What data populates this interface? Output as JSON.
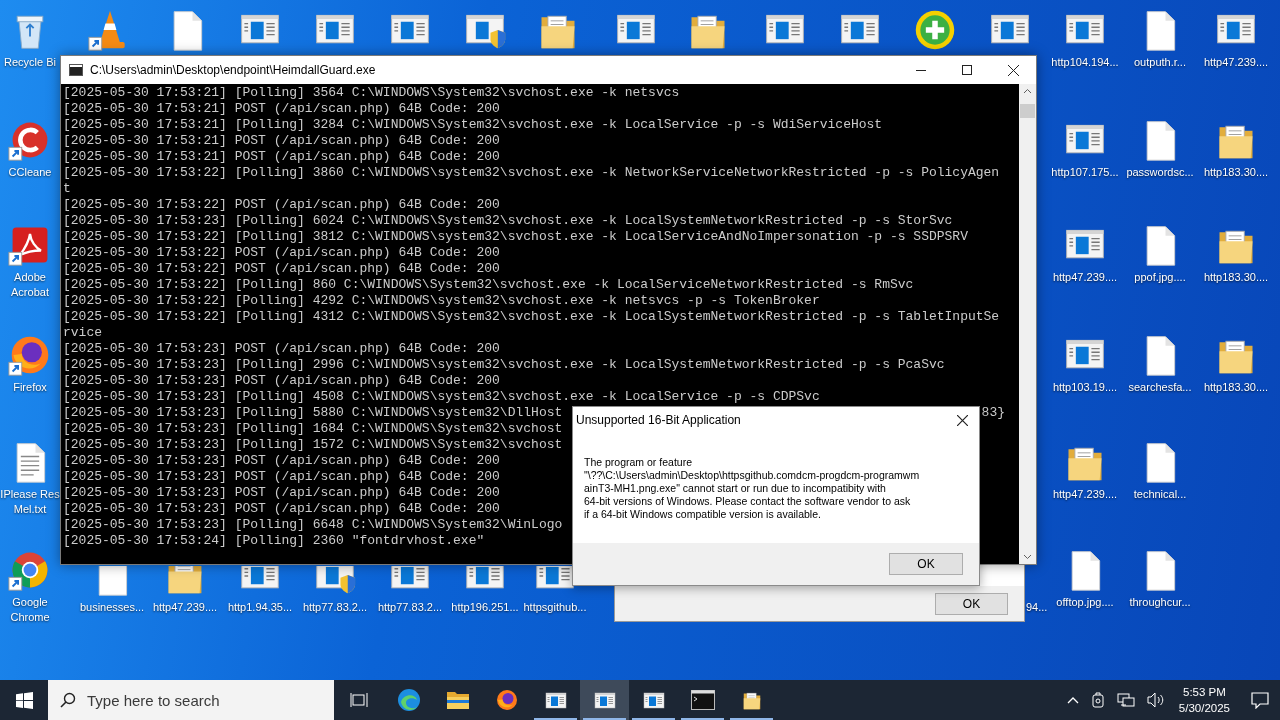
{
  "desktop_icons": [
    {
      "kind": "recycle",
      "label": "Recycle Bi",
      "shortcut": false
    },
    {
      "kind": "ccleaner",
      "label": "CCleane",
      "shortcut": true
    },
    {
      "kind": "acrobat",
      "label": "Adobe\nAcrobat",
      "shortcut": true
    },
    {
      "kind": "firefox",
      "label": "Firefox",
      "shortcut": true
    },
    {
      "kind": "txt",
      "label": "IPlease Res\nMel.txt",
      "shortcut": false
    },
    {
      "kind": "chrome",
      "label": "Google\nChrome",
      "shortcut": true
    },
    {
      "kind": "vlc",
      "shortcut": true
    },
    {
      "kind": "doc",
      "shortcut": false
    },
    {
      "kind": "exe",
      "shortcut": false
    },
    {
      "kind": "exe",
      "shortcut": false
    },
    {
      "kind": "exe",
      "shortcut": false
    },
    {
      "kind": "shield",
      "shortcut": false
    },
    {
      "kind": "folder",
      "shortcut": false
    },
    {
      "kind": "exe",
      "shortcut": false
    },
    {
      "kind": "folder",
      "shortcut": false
    },
    {
      "kind": "exe",
      "shortcut": false
    },
    {
      "kind": "exe",
      "shortcut": false
    },
    {
      "kind": "plus",
      "shortcut": false
    },
    {
      "kind": "exe",
      "shortcut": false
    },
    {
      "kind": "exe",
      "label": "http104.194...",
      "shortcut": false
    },
    {
      "kind": "exe",
      "label": "http107.175...",
      "shortcut": false
    },
    {
      "kind": "exe",
      "label": "http47.239....",
      "shortcut": false
    },
    {
      "kind": "exe",
      "label": "http103.19....",
      "shortcut": false
    },
    {
      "kind": "folder",
      "label": "http47.239....",
      "shortcut": false
    },
    {
      "kind": "doc",
      "label": "offtop.jpg....",
      "shortcut": false
    },
    {
      "kind": "doc",
      "label": "outputh.r...",
      "shortcut": false
    },
    {
      "kind": "doc",
      "label": "passwordsc...",
      "shortcut": false
    },
    {
      "kind": "doc",
      "label": "ppof.jpg....",
      "shortcut": false
    },
    {
      "kind": "doc",
      "label": "searchesfa...",
      "shortcut": false
    },
    {
      "kind": "doc",
      "label": "technical...",
      "shortcut": false
    },
    {
      "kind": "doc",
      "label": "throughcur...",
      "shortcut": false
    },
    {
      "kind": "exe",
      "label": "http47.239....",
      "shortcut": false
    },
    {
      "kind": "folder",
      "label": "http183.30....",
      "shortcut": false
    },
    {
      "kind": "folder",
      "label": "http183.30....",
      "shortcut": false
    },
    {
      "kind": "folder",
      "label": "http183.30....",
      "shortcut": false
    },
    {
      "kind": "doc",
      "label": "businesses...",
      "shortcut": false
    },
    {
      "kind": "folder",
      "label": "http47.239....",
      "shortcut": false
    },
    {
      "kind": "exe",
      "label": "http1.94.35...",
      "shortcut": false
    },
    {
      "kind": "shield",
      "label": "http77.83.2...",
      "shortcut": false
    },
    {
      "kind": "exe",
      "label": "http77.83.2...",
      "shortcut": false
    },
    {
      "kind": "exe",
      "label": "http196.251...",
      "shortcut": false
    },
    {
      "kind": "exe",
      "label": "httpsgithub...",
      "shortcut": false
    },
    {
      "kind": "hidden",
      "label": "94..."
    }
  ],
  "console_window": {
    "title": "C:\\Users\\admin\\Desktop\\endpoint\\HeimdallGuard.exe",
    "lines": [
      {
        "text": "[2025-05-30 17:53:21] [Polling] 3564 C:\\WINDOWS\\System32\\svchost.exe -k netsvcs"
      },
      {
        "text": "[2025-05-30 17:53:21] POST (/api/scan.php) 64B Code: 200"
      },
      {
        "text": "[2025-05-30 17:53:21] [Polling] 3284 C:\\WINDOWS\\System32\\svchost.exe -k LocalService -p -s WdiServiceHost"
      },
      {
        "text": "[2025-05-30 17:53:21] POST (/api/scan.php) 64B Code: 200"
      },
      {
        "text": "[2025-05-30 17:53:21] POST (/api/scan.php) 64B Code: 200"
      },
      {
        "text": "[2025-05-30 17:53:22] [Polling] 3860 C:\\WINDOWS\\system32\\svchost.exe -k NetworkServiceNetworkRestricted -p -s PolicyAgen"
      },
      {
        "text": "t"
      },
      {
        "text": "[2025-05-30 17:53:22] POST (/api/scan.php) 64B Code: 200"
      },
      {
        "text": "[2025-05-30 17:53:23] [Polling] 6024 C:\\WINDOWS\\System32\\svchost.exe -k LocalSystemNetworkRestricted -p -s StorSvc"
      },
      {
        "text": "[2025-05-30 17:53:22] [Polling] 3812 C:\\WINDOWS\\system32\\svchost.exe -k LocalServiceAndNoImpersonation -p -s SSDPSRV"
      },
      {
        "text": "[2025-05-30 17:53:22] POST (/api/scan.php) 64B Code: 200"
      },
      {
        "text": "[2025-05-30 17:53:22] POST (/api/scan.php) 64B Code: 200"
      },
      {
        "text": "[2025-05-30 17:53:22] [Polling] 860 C:\\WINDOWS\\System32\\svchost.exe -k LocalServiceNetworkRestricted -s RmSvc"
      },
      {
        "text": "[2025-05-30 17:53:22] [Polling] 4292 C:\\WINDOWS\\system32\\svchost.exe -k netsvcs -p -s TokenBroker"
      },
      {
        "text": "[2025-05-30 17:53:22] [Polling] 4312 C:\\WINDOWS\\System32\\svchost.exe -k LocalSystemNetworkRestricted -p -s TabletInputSe"
      },
      {
        "text": "rvice"
      },
      {
        "text": "[2025-05-30 17:53:23] POST (/api/scan.php) 64B Code: 200"
      },
      {
        "text": "[2025-05-30 17:53:23] [Polling] 2996 C:\\WINDOWS\\system32\\svchost.exe -k LocalSystemNetworkRestricted -p -s PcaSvc"
      },
      {
        "text": "[2025-05-30 17:53:23] POST (/api/scan.php) 64B Code: 200"
      },
      {
        "text": "[2025-05-30 17:53:23] [Polling] 4508 C:\\WINDOWS\\system32\\svchost.exe -k LocalService -p -s CDPSvc"
      },
      {
        "text": "[2025-05-30 17:53:23] [Polling] 5880 C:\\WINDOWS\\system32\\DllHost",
        "tail": "83}"
      },
      {
        "text": "[2025-05-30 17:53:23] [Polling] 1684 C:\\WINDOWS\\System32\\svchost"
      },
      {
        "text": "[2025-05-30 17:53:23] [Polling] 1572 C:\\WINDOWS\\System32\\svchost"
      },
      {
        "text": "[2025-05-30 17:53:23] POST (/api/scan.php) 64B Code: 200"
      },
      {
        "text": "[2025-05-30 17:53:23] POST (/api/scan.php) 64B Code: 200"
      },
      {
        "text": "[2025-05-30 17:53:23] POST (/api/scan.php) 64B Code: 200"
      },
      {
        "text": "[2025-05-30 17:53:23] POST (/api/scan.php) 64B Code: 200"
      },
      {
        "text": "[2025-05-30 17:53:23] [Polling] 6648 C:\\WINDOWS\\System32\\WinLogo"
      },
      {
        "text": "[2025-05-30 17:53:24] [Polling] 2360 \"fontdrvhost.exe\""
      }
    ]
  },
  "error_dialog": {
    "title": "Unsupported 16-Bit Application",
    "message": "The program or feature\n\"\\??\\C:\\Users\\admin\\Desktop\\httpsgithub.comdcm-progdcm-programwm\nainT3-MH1.png.exe\" cannot start or run due to incompatibity with\n64-bit versions of Windows. Please contact the software vendor to ask\nif a 64-bit Windows compatible version is available.",
    "button": "OK"
  },
  "background_dialog": {
    "button": "OK"
  },
  "taskbar": {
    "search": {
      "placeholder": "Type here to search"
    },
    "apps": [
      {
        "kind": "taskview",
        "running": false,
        "selected": false
      },
      {
        "kind": "edge",
        "running": false,
        "selected": false
      },
      {
        "kind": "explorer",
        "running": false,
        "selected": false
      },
      {
        "kind": "firefox",
        "running": false,
        "selected": false
      },
      {
        "kind": "window",
        "running": true,
        "selected": false
      },
      {
        "kind": "window",
        "running": true,
        "selected": true
      },
      {
        "kind": "window",
        "running": true,
        "selected": false
      },
      {
        "kind": "cmd",
        "running": true,
        "selected": false
      },
      {
        "kind": "folder",
        "running": true,
        "selected": false
      }
    ],
    "time": "5:53 PM",
    "date": "5/30/2025"
  }
}
